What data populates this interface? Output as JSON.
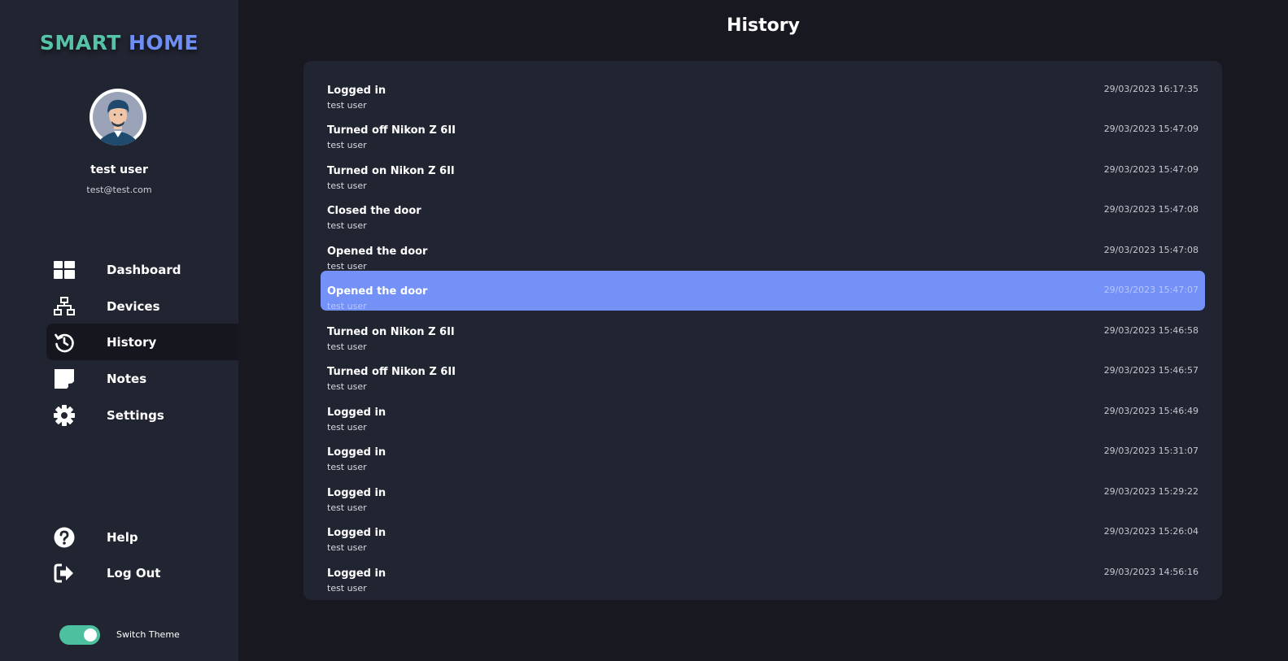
{
  "app": {
    "logo_part1": "SMART",
    "logo_part2": "HOME",
    "brand_colors": {
      "green": "#56c2a7",
      "blue": "#6f8ef5",
      "highlight": "#7391f7"
    }
  },
  "user": {
    "name": "test user",
    "email": "test@test.com",
    "avatar_icon": "user-avatar"
  },
  "sidebar": {
    "nav": [
      {
        "label": "Dashboard",
        "icon": "dashboard-icon"
      },
      {
        "label": "Devices",
        "icon": "network-icon"
      },
      {
        "label": "History",
        "icon": "history-icon",
        "active": true
      },
      {
        "label": "Notes",
        "icon": "note-icon"
      },
      {
        "label": "Settings",
        "icon": "gear-icon"
      }
    ],
    "bottom": [
      {
        "label": "Help",
        "icon": "question-icon"
      },
      {
        "label": "Log Out",
        "icon": "logout-icon"
      }
    ],
    "theme_toggle": {
      "label": "Switch Theme",
      "on": true
    }
  },
  "page": {
    "title": "History"
  },
  "history": [
    {
      "action": "Logged in",
      "user": "test user",
      "time": "29/03/2023 16:17:35"
    },
    {
      "action": "Turned off Nikon Z 6II",
      "user": "test user",
      "time": "29/03/2023 15:47:09"
    },
    {
      "action": "Turned on Nikon Z 6II",
      "user": "test user",
      "time": "29/03/2023 15:47:09"
    },
    {
      "action": "Closed the door",
      "user": "test user",
      "time": "29/03/2023 15:47:08"
    },
    {
      "action": "Opened the door",
      "user": "test user",
      "time": "29/03/2023 15:47:08"
    },
    {
      "action": "Opened the door",
      "user": "test user",
      "time": "29/03/2023 15:47:07",
      "highlighted": true
    },
    {
      "action": "Turned on Nikon Z 6II",
      "user": "test user",
      "time": "29/03/2023 15:46:58"
    },
    {
      "action": "Turned off Nikon Z 6II",
      "user": "test user",
      "time": "29/03/2023 15:46:57"
    },
    {
      "action": "Logged in",
      "user": "test user",
      "time": "29/03/2023 15:46:49"
    },
    {
      "action": "Logged in",
      "user": "test user",
      "time": "29/03/2023 15:31:07"
    },
    {
      "action": "Logged in",
      "user": "test user",
      "time": "29/03/2023 15:29:22"
    },
    {
      "action": "Logged in",
      "user": "test user",
      "time": "29/03/2023 15:26:04"
    },
    {
      "action": "Logged in",
      "user": "test user",
      "time": "29/03/2023 14:56:16"
    }
  ]
}
